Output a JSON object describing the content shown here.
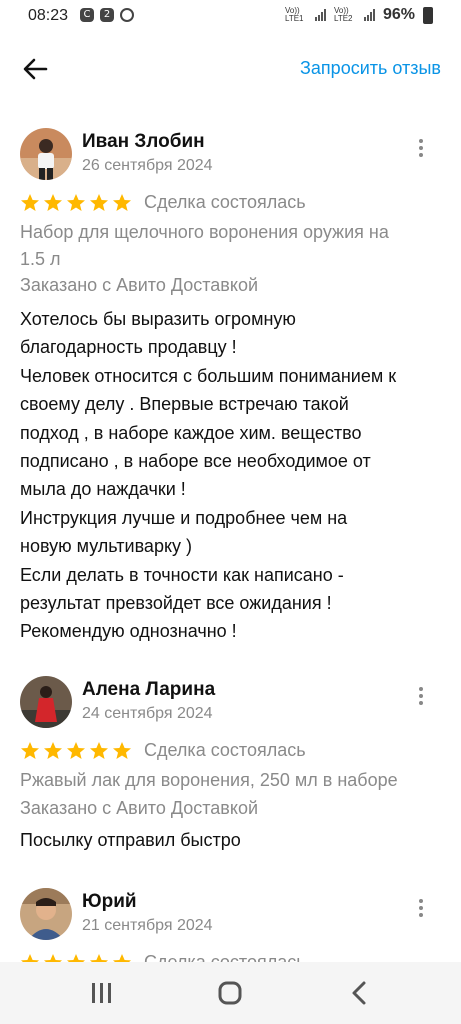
{
  "status_bar": {
    "time": "08:23",
    "notif_icons": [
      "C",
      "2",
      "◉"
    ],
    "sim1": "Vo)) LTE1",
    "sim2": "Vo)) LTE2",
    "battery": "96%"
  },
  "header": {
    "request_review_label": "Запросить отзыв"
  },
  "reviews": [
    {
      "name": "Иван Злобин",
      "date": "26 сентября 2024",
      "stars": 5,
      "deal_status": "Сделка состоялась",
      "item_lines": [
        "Набор для щелочного воронения оружия на",
        "1.5 л"
      ],
      "delivery": "Заказано с Авито Доставкой",
      "text_lines": [
        "Хотелось бы выразить огромную",
        "благодарность продавцу !",
        "Человек относится с большим пониманием к",
        "своему делу . Впервые встречаю такой",
        "подход , в наборе каждое хим. вещество",
        "подписано , в наборе все необходимое от",
        "мыла до наждачки !",
        "Инструкция лучше и подробнее чем на",
        "новую мультиварку )",
        "Если делать в точности как написано -",
        "результат превзойдет все ожидания !",
        "Рекомендую однозначно !"
      ]
    },
    {
      "name": "Алена Ларина",
      "date": "24 сентября 2024",
      "stars": 5,
      "deal_status": "Сделка состоялась",
      "item_lines": [
        "Ржавый лак для воронения, 250 мл в наборе"
      ],
      "delivery": "Заказано с Авито Доставкой",
      "text_lines": [
        "Посылку отправил быстро"
      ]
    },
    {
      "name": "Юрий",
      "date": "21 сентября 2024",
      "stars": 5,
      "deal_status": "Сделка состоялась"
    }
  ],
  "colors": {
    "accent": "#0a94e6",
    "star": "#ffb800",
    "muted_text": "#8a8a8a"
  }
}
